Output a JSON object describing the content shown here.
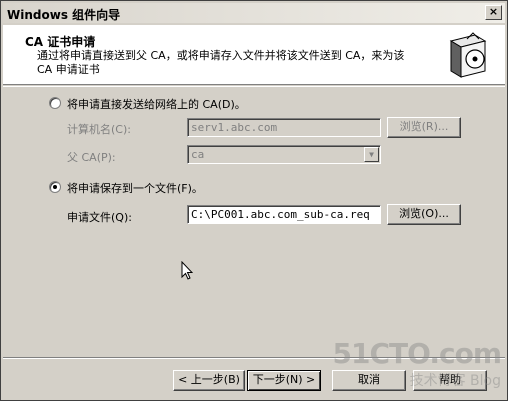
{
  "window": {
    "title": "Windows 组件向导",
    "close_label": "×"
  },
  "header": {
    "title": "CA 证书申请",
    "description": "通过将申请直接送到父 CA，或将申请存入文件并将该文件送到 CA，来为该 CA 申请证书"
  },
  "option_network": {
    "label": "将申请直接发送给网络上的 CA(D)。",
    "computer_label": "计算机名(C):",
    "computer_value": "serv1.abc.com",
    "browse_label": "浏览(R)...",
    "parent_ca_label": "父 CA(P):",
    "parent_ca_value": "ca"
  },
  "option_file": {
    "label": "将申请保存到一个文件(F)。",
    "file_label": "申请文件(Q):",
    "file_value": "C:\\PC001.abc.com_sub-ca.req",
    "browse_label": "浏览(O)..."
  },
  "footer": {
    "back_label": "< 上一步(B)",
    "next_label": "下一步(N) >",
    "cancel_label": "取消",
    "help_label": "帮助"
  },
  "watermark": {
    "line1": "51CTO.com",
    "line2": "技术博客 Blog"
  }
}
